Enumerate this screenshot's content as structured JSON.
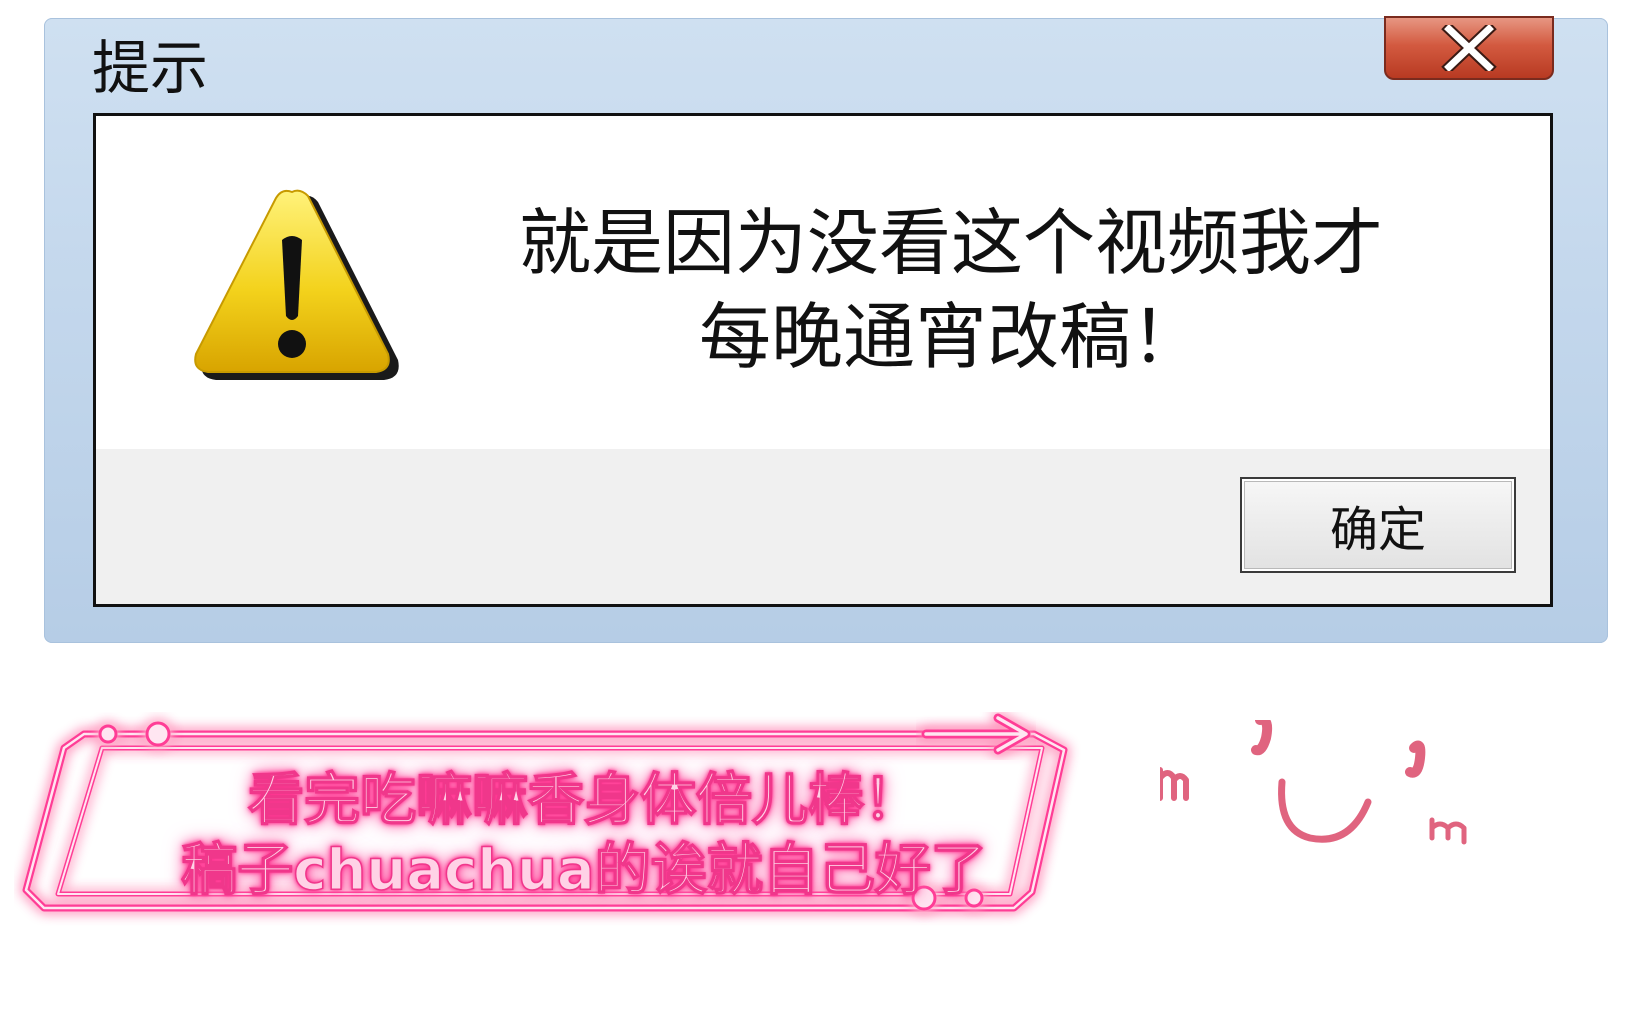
{
  "dialog": {
    "title": "提示",
    "message_lines": [
      "就是因为没看这个视频我才",
      "每晚通宵改稿！"
    ],
    "ok_label": "确定",
    "close_icon": "close-x-icon",
    "warning_icon": "warning-triangle-icon"
  },
  "caption": {
    "lines": [
      "看完吃嘛嘛香身体倍儿棒！",
      "稿子chuachua的诶就自己好了"
    ],
    "arrow_icon": "arrow-right-icon"
  },
  "doodle": {
    "icon": "smiley-face-icon"
  },
  "colors": {
    "frame_blue": "#c3d7ec",
    "close_red": "#d35a40",
    "warning_yellow": "#f3d21c",
    "neon_pink": "#ff2f8e",
    "doodle_pink": "#e0647f"
  }
}
